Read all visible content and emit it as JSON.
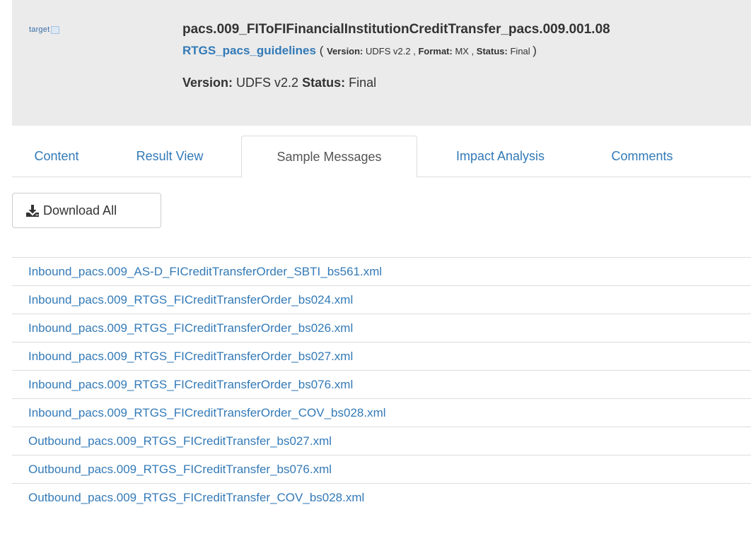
{
  "header": {
    "logo_text": "target",
    "title": "pacs.009_FIToFIFinancialInstitutionCreditTransfer_pacs.009.001.08",
    "guideline_link": "RTGS_pacs_guidelines",
    "paren_open": "(",
    "paren_close": ")",
    "version_label": "Version:",
    "version_value": "UDFS v2.2",
    "format_label": "Format:",
    "format_value": "MX",
    "status_label": "Status:",
    "status_value": "Final",
    "line_version_label": "Version:",
    "line_version_value": "UDFS v2.2",
    "line_status_label": "Status:",
    "line_status_value": "Final"
  },
  "tabs": [
    {
      "label": "Content"
    },
    {
      "label": "Result View"
    },
    {
      "label": "Sample Messages",
      "active": true
    },
    {
      "label": "Impact Analysis"
    },
    {
      "label": "Comments"
    }
  ],
  "download": {
    "label": "Download All",
    "icon": "download-icon"
  },
  "files": [
    "Inbound_pacs.009_AS-D_FICreditTransferOrder_SBTI_bs561.xml",
    "Inbound_pacs.009_RTGS_FICreditTransferOrder_bs024.xml",
    "Inbound_pacs.009_RTGS_FICreditTransferOrder_bs026.xml",
    "Inbound_pacs.009_RTGS_FICreditTransferOrder_bs027.xml",
    "Inbound_pacs.009_RTGS_FICreditTransferOrder_bs076.xml",
    "Inbound_pacs.009_RTGS_FICreditTransferOrder_COV_bs028.xml",
    "Outbound_pacs.009_RTGS_FICreditTransfer_bs027.xml",
    "Outbound_pacs.009_RTGS_FICreditTransfer_bs076.xml",
    "Outbound_pacs.009_RTGS_FICreditTransfer_COV_bs028.xml"
  ],
  "colors": {
    "link": "#337ab7",
    "header_bg": "#ebebeb",
    "text": "#333333"
  }
}
